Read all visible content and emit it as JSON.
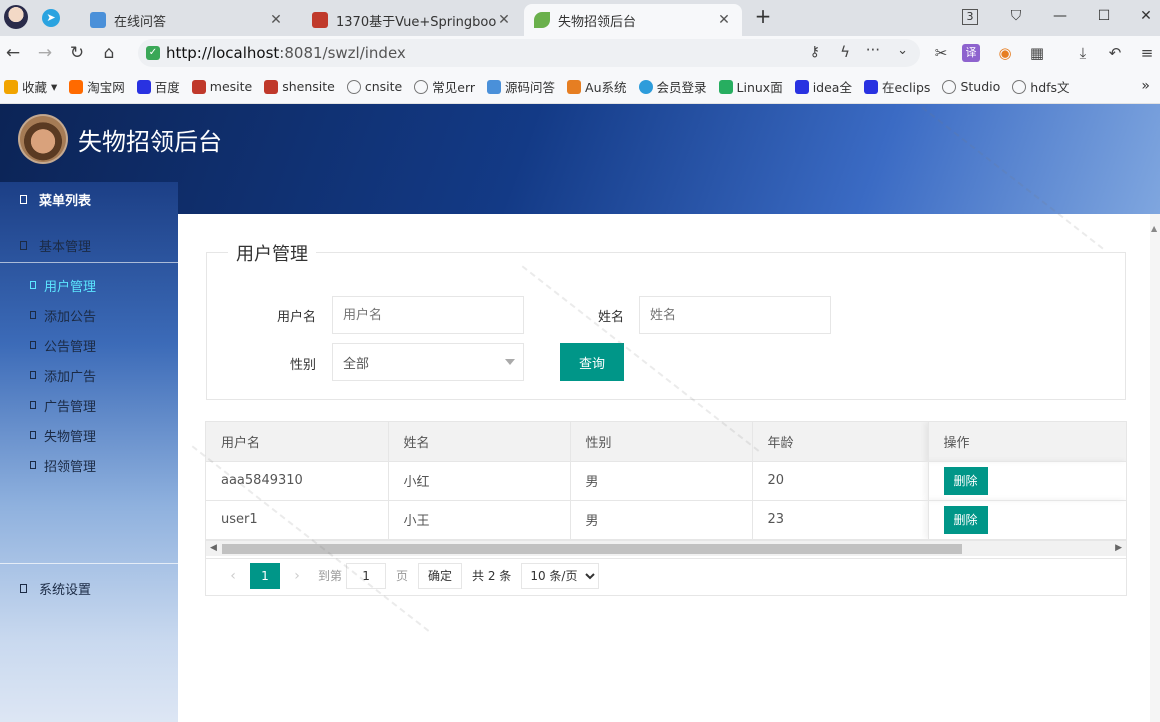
{
  "browser": {
    "tabs": [
      {
        "label": "在线问答",
        "favicon_color": "#4a90d9"
      },
      {
        "label": "1370基于Vue+Springboot篇",
        "favicon_color": "#c0392b"
      },
      {
        "label": "失物招领后台",
        "favicon_color": "#6ab04c"
      }
    ],
    "url_host": "http://localhost",
    "url_path": ":8081/swzl/index",
    "bookmarks": [
      {
        "label": "收藏",
        "color": "#f1a400"
      },
      {
        "label": "淘宝网",
        "color": "#ff6a00"
      },
      {
        "label": "百度",
        "color": "#2932e1"
      },
      {
        "label": "mesite",
        "color": "#c0392b"
      },
      {
        "label": "shensite",
        "color": "#c0392b"
      },
      {
        "label": "cnsite",
        "color": "#777"
      },
      {
        "label": "常见err",
        "color": "#777"
      },
      {
        "label": "源码问答",
        "color": "#4a90d9"
      },
      {
        "label": "Au系统",
        "color": "#e67e22"
      },
      {
        "label": "会员登录",
        "color": "#2d9cdb"
      },
      {
        "label": "Linux面",
        "color": "#27ae60"
      },
      {
        "label": "idea全",
        "color": "#2932e1"
      },
      {
        "label": "在eclips",
        "color": "#2932e1"
      },
      {
        "label": "Studio",
        "color": "#777"
      },
      {
        "label": "hdfs文",
        "color": "#777"
      }
    ]
  },
  "app": {
    "title": "失物招领后台",
    "menu_header": "菜单列表",
    "group_basic": "基本管理",
    "group_system": "系统设置",
    "submenu": [
      {
        "label": "用户管理",
        "active": true
      },
      {
        "label": "添加公告",
        "active": false
      },
      {
        "label": "公告管理",
        "active": false
      },
      {
        "label": "添加广告",
        "active": false
      },
      {
        "label": "广告管理",
        "active": false
      },
      {
        "label": "失物管理",
        "active": false
      },
      {
        "label": "招领管理",
        "active": false
      }
    ]
  },
  "search": {
    "legend": "用户管理",
    "username_label": "用户名",
    "username_placeholder": "用户名",
    "name_label": "姓名",
    "name_placeholder": "姓名",
    "gender_label": "性别",
    "gender_selected": "全部",
    "query_button": "查询"
  },
  "table": {
    "columns": [
      "用户名",
      "姓名",
      "性别",
      "年龄",
      "操作"
    ],
    "rows": [
      {
        "username": "aaa5849310",
        "name": "小红",
        "gender": "男",
        "age": "20",
        "action": "删除"
      },
      {
        "username": "user1",
        "name": "小王",
        "gender": "男",
        "age": "23",
        "action": "删除"
      }
    ]
  },
  "pager": {
    "current_page": "1",
    "goto_label": "到第",
    "goto_value": "1",
    "page_unit": "页",
    "confirm": "确定",
    "total": "共 2 条",
    "limit": "10 条/页"
  },
  "colors": {
    "accent": "#009688",
    "active_menu": "#5ce6ff"
  }
}
